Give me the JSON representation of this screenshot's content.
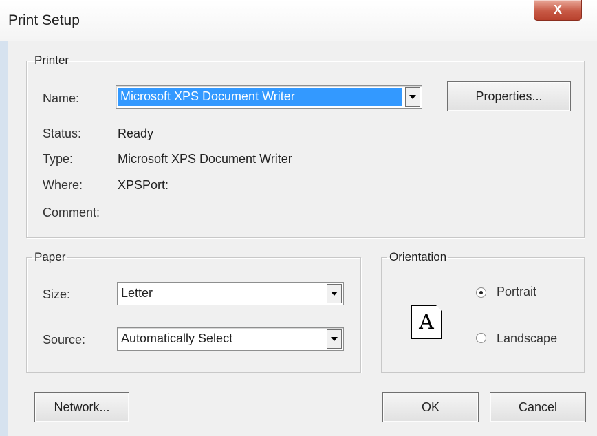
{
  "window": {
    "title": "Print Setup",
    "close_label": "X"
  },
  "printer": {
    "legend": "Printer",
    "name_label": "Name:",
    "name_value": "Microsoft XPS Document Writer",
    "properties_label": "Properties...",
    "status_label": "Status:",
    "status_value": "Ready",
    "type_label": "Type:",
    "type_value": "Microsoft XPS Document Writer",
    "where_label": "Where:",
    "where_value": "XPSPort:",
    "comment_label": "Comment:",
    "comment_value": ""
  },
  "paper": {
    "legend": "Paper",
    "size_label": "Size:",
    "size_value": "Letter",
    "source_label": "Source:",
    "source_value": "Automatically Select"
  },
  "orientation": {
    "legend": "Orientation",
    "icon_letter": "A",
    "portrait_label": "Portrait",
    "landscape_label": "Landscape",
    "selected": "portrait"
  },
  "buttons": {
    "network": "Network...",
    "ok": "OK",
    "cancel": "Cancel"
  },
  "colors": {
    "selection": "#3399ff",
    "close_button": "#c85a46"
  }
}
